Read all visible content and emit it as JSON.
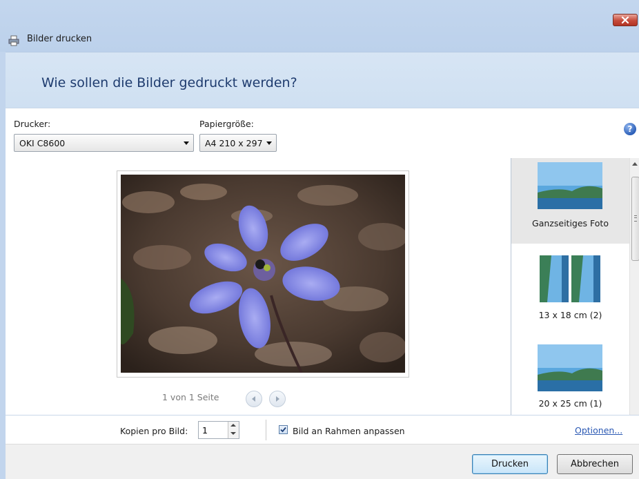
{
  "window": {
    "title": "Bilder drucken",
    "close_icon": "close-icon",
    "printer_icon": "printer-icon"
  },
  "header": {
    "heading": "Wie sollen die Bilder gedruckt werden?"
  },
  "printer": {
    "label": "Drucker:",
    "value": "OKI C8600"
  },
  "paper": {
    "label": "Papiergröße:",
    "value": "A4 210 x 297"
  },
  "help_icon": "help-icon",
  "preview": {
    "page_status": "1 von 1 Seite",
    "prev_icon": "prev-page-icon",
    "next_icon": "next-page-icon"
  },
  "layouts": [
    {
      "label": "Ganzseitiges Foto",
      "selected": true
    },
    {
      "label": "13 x 18 cm (2)",
      "selected": false
    },
    {
      "label": "20 x 25 cm (1)",
      "selected": false
    }
  ],
  "options": {
    "copies_label": "Kopien pro Bild:",
    "copies_value": "1",
    "fit_label": "Bild an Rahmen anpassen",
    "fit_checked": true,
    "options_link": "Optionen..."
  },
  "buttons": {
    "print": "Drucken",
    "cancel": "Abbrechen"
  },
  "colors": {
    "titlebar": "#c3d6ee",
    "heading_text": "#1e3b6e",
    "link": "#2a58b3"
  }
}
